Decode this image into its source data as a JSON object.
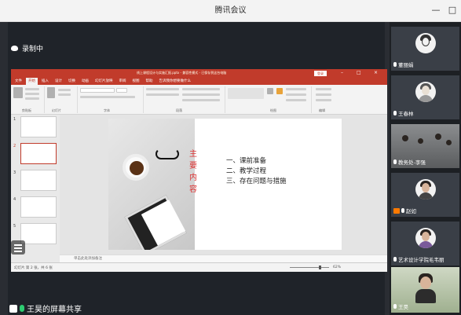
{
  "window": {
    "title": "腾讯会议",
    "minimize": "—",
    "maximize": "□"
  },
  "recording": {
    "label": "录制中"
  },
  "share": {
    "label": "王昊的屏幕共享"
  },
  "ppt": {
    "title_text": "线上课程设计与实施汇报.pptx - 兼容性模式 - 已保存到这台电脑",
    "login": "登录",
    "tabs": [
      "文件",
      "开始",
      "插入",
      "设计",
      "切换",
      "动画",
      "幻灯片放映",
      "审阅",
      "视图",
      "帮助",
      "告诉我你想要做什么"
    ],
    "active_tab": 1,
    "groups": [
      "剪贴板",
      "幻灯片",
      "字体",
      "段落",
      "绘图",
      "编辑"
    ],
    "thumbs": [
      {
        "num": "1"
      },
      {
        "num": "2"
      },
      {
        "num": "3"
      },
      {
        "num": "4"
      },
      {
        "num": "5"
      }
    ],
    "selected_thumb": 1,
    "slide": {
      "vertical_title": [
        "主",
        "要",
        "内",
        "容"
      ],
      "items": [
        "一、课前准备",
        "二、教学过程",
        "三、存在问题与措施"
      ]
    },
    "notes_placeholder": "单击此处添加备注",
    "status_left": "幻灯片 第 2 张，共 6 张",
    "status_zoom": "62%"
  },
  "participants": [
    {
      "name": "董丽娟",
      "kind": "avatar-cartoon"
    },
    {
      "name": "王春林",
      "kind": "avatar-sketch"
    },
    {
      "name": "教务处-李强",
      "kind": "room"
    },
    {
      "name": "赵如",
      "kind": "avatar-photo",
      "camera_off": true
    },
    {
      "name": "艺术设计学院毛韦丽",
      "kind": "avatar-photo"
    },
    {
      "name": "王昊",
      "kind": "video"
    }
  ]
}
